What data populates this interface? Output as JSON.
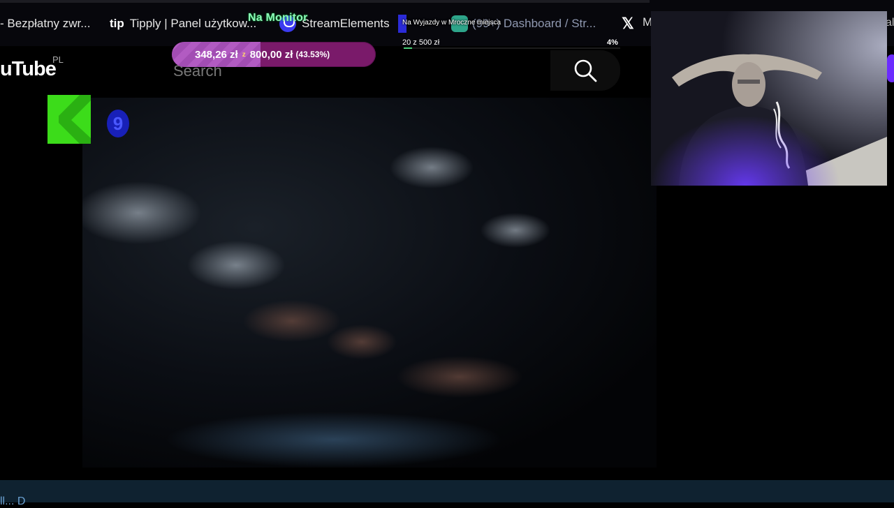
{
  "browser": {
    "tabs": [
      {
        "label": "- Bezpłatny zwr..."
      },
      {
        "label": "Tipply | Panel użytkow...",
        "icon": "tipply-icon",
        "icon_text": "tip"
      },
      {
        "label": "StreamElements",
        "icon": "streamelements-icon"
      },
      {
        "label": "(99+) Dashboard / Str...",
        "icon": "dashboard-icon"
      },
      {
        "label": "M",
        "icon": "x-icon"
      }
    ],
    "edge_label": "al"
  },
  "overlays": {
    "monitor_label": "Na Monitor",
    "route_label": "Na Wyjazdy w Mroczne miejsca",
    "goal_count": "20 z 500 zł",
    "goal_percent": "4%",
    "goal_fraction": 0.04,
    "donation": {
      "current": "348,26 zł",
      "separator": "z",
      "target": "800,00 zł",
      "percent": "(43.53%)",
      "fraction": 0.4353
    }
  },
  "youtube": {
    "logo": "uTube",
    "region": "PL",
    "search_placeholder": "Search"
  },
  "channel_logo": {
    "letter": "K",
    "digit": "9"
  },
  "bottom": {
    "text": "ll... D"
  },
  "colors": {
    "donation_bar": "#7a1a6a",
    "donation_fill": "#b25bc2",
    "monitor_label": "#8df7b8",
    "k_logo": "#3cdc1a",
    "nine_logo": "#2830d8",
    "bottom_bar": "#0f2230"
  }
}
